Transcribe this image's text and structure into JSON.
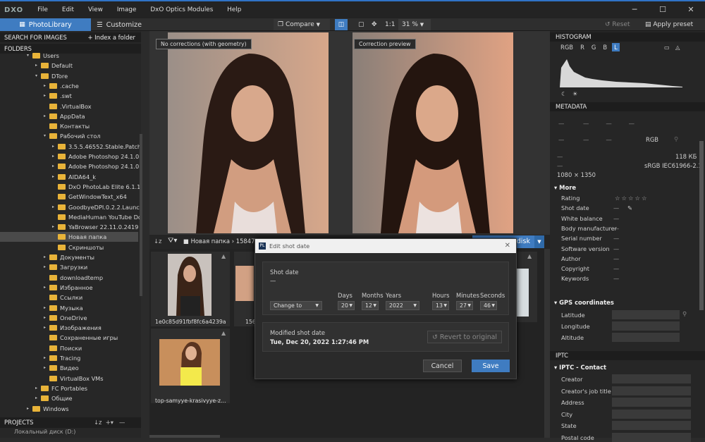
{
  "menubar": {
    "logo": "DXO",
    "items": [
      "File",
      "Edit",
      "View",
      "Image",
      "DxO Optics Modules",
      "Help"
    ]
  },
  "toolbar": {
    "tab_library": "PhotoLibrary",
    "tab_customize": "Customize",
    "compare": "Compare",
    "ratio": "1:1",
    "zoom": "31 %",
    "reset": "Reset",
    "apply_preset": "Apply preset"
  },
  "left": {
    "search": "SEARCH FOR IMAGES",
    "index": "+ Index a folder",
    "folders": "FOLDERS",
    "projects": "PROJECTS",
    "cut_item": "Локальный диск (D:)",
    "tree": [
      {
        "label": "Users",
        "indent": 0,
        "arrow": "▾"
      },
      {
        "label": "Default",
        "indent": 1,
        "arrow": "▸"
      },
      {
        "label": "DTore",
        "indent": 1,
        "arrow": "▾"
      },
      {
        "label": ".cache",
        "indent": 2,
        "arrow": "▸"
      },
      {
        "label": ".swt",
        "indent": 2,
        "arrow": "▸"
      },
      {
        "label": ".VirtualBox",
        "indent": 2,
        "arrow": ""
      },
      {
        "label": "AppData",
        "indent": 2,
        "arrow": "▸"
      },
      {
        "label": "Контакты",
        "indent": 2,
        "arrow": ""
      },
      {
        "label": "Рабочий стол",
        "indent": 2,
        "arrow": "▾"
      },
      {
        "label": "3.5.5.46552.Stable.Patch.PRC",
        "indent": 3,
        "arrow": "▸"
      },
      {
        "label": "Adobe Photoshop 24.1.0.166",
        "indent": 3,
        "arrow": "▸"
      },
      {
        "label": "Adobe Photoshop 24.1.0.166",
        "indent": 3,
        "arrow": "▸"
      },
      {
        "label": "AIDA64_k",
        "indent": 3,
        "arrow": "▸"
      },
      {
        "label": "DxO PhotoLab Elite 6.1.1 bui",
        "indent": 3,
        "arrow": ""
      },
      {
        "label": "GetWindowText_x64",
        "indent": 3,
        "arrow": ""
      },
      {
        "label": "GoodbyeDPI.0.2.2.Launcher.",
        "indent": 3,
        "arrow": "▸"
      },
      {
        "label": "MediaHuman YouTube Dow",
        "indent": 3,
        "arrow": ""
      },
      {
        "label": "YaBrowser 22.11.0.2419 x64",
        "indent": 3,
        "arrow": "▸"
      },
      {
        "label": "Новая папка",
        "indent": 3,
        "arrow": "",
        "selected": true
      },
      {
        "label": "Скриншоты",
        "indent": 3,
        "arrow": ""
      },
      {
        "label": "Документы",
        "indent": 2,
        "arrow": "▸"
      },
      {
        "label": "Загрузки",
        "indent": 2,
        "arrow": "▸"
      },
      {
        "label": "downloadtemp",
        "indent": 2,
        "arrow": ""
      },
      {
        "label": "Избранное",
        "indent": 2,
        "arrow": "▸"
      },
      {
        "label": "Ссылки",
        "indent": 2,
        "arrow": ""
      },
      {
        "label": "Музыка",
        "indent": 2,
        "arrow": "▸"
      },
      {
        "label": "OneDrive",
        "indent": 2,
        "arrow": "▸"
      },
      {
        "label": "Изображения",
        "indent": 2,
        "arrow": "▸"
      },
      {
        "label": "Сохраненные игры",
        "indent": 2,
        "arrow": ""
      },
      {
        "label": "Поиски",
        "indent": 2,
        "arrow": ""
      },
      {
        "label": "Tracing",
        "indent": 2,
        "arrow": "▸"
      },
      {
        "label": "Видео",
        "indent": 2,
        "arrow": "▸"
      },
      {
        "label": "VirtualBox VMs",
        "indent": 2,
        "arrow": ""
      },
      {
        "label": "FC Portables",
        "indent": 1,
        "arrow": "▸"
      },
      {
        "label": "Общие",
        "indent": 1,
        "arrow": "▸"
      },
      {
        "label": "Windows",
        "indent": 0,
        "arrow": "▸"
      }
    ]
  },
  "viewer": {
    "left_label": "No corrections (with geometry)",
    "right_label": "Correction preview"
  },
  "filmstrip": {
    "path": "Новая папка",
    "count_cut": "15847036",
    "export_label": "disk",
    "thumbs": [
      "1e0c85d91fbf8fc6a4239a...",
      "top-samyye-krasivyye-z..."
    ],
    "partial_name": "156"
  },
  "dialog": {
    "title": "Edit shot date",
    "section_label": "Shot date",
    "dash": "—",
    "mode": "Change to",
    "days_label": "Days",
    "months_label": "Months",
    "years_label": "Years",
    "hours_label": "Hours",
    "minutes_label": "Minutes",
    "seconds_label": "Seconds",
    "days": "20",
    "months": "12",
    "years": "2022",
    "hours": "13",
    "minutes": "27",
    "seconds": "46",
    "modified_label": "Modified shot date",
    "modified_value": "Tue, Dec 20, 2022 1:27:46 PM",
    "revert": "Revert to original",
    "cancel": "Cancel",
    "save": "Save"
  },
  "right": {
    "histogram": "HISTOGRAM",
    "channels": [
      "RGB",
      "R",
      "G",
      "B",
      "L"
    ],
    "metadata": "METADATA",
    "rgb": "RGB",
    "size": "118 КБ",
    "colorspace": "sRGB IEC61966-2.1",
    "dims": "1080 × 1350",
    "more": "More",
    "fields": [
      "Rating",
      "Shot date",
      "White balance",
      "Body manufacturer",
      "Serial number",
      "Software version",
      "Author",
      "Copyright",
      "Keywords"
    ],
    "gps": "GPS coordinates",
    "gps_fields": [
      "Latitude",
      "Longitude",
      "Altitude"
    ],
    "iptc": "IPTC",
    "iptc_contact": "IPTC - Contact",
    "iptc_fields": [
      "Creator",
      "Creator's job title",
      "Address",
      "City",
      "State",
      "Postal code"
    ]
  }
}
